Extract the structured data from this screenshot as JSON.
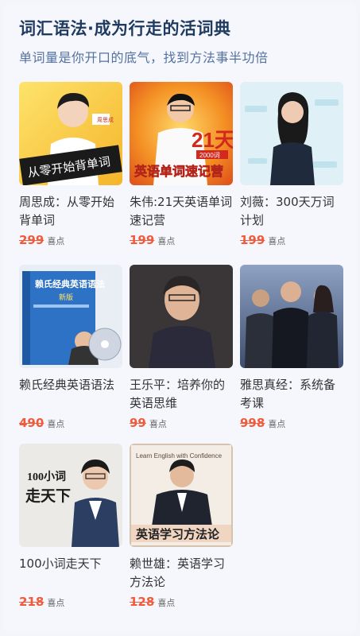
{
  "header": {
    "title": "词汇语法·成为行走的活词典",
    "subtitle": "单词量是你开口的底气，找到方法事半功倍"
  },
  "courses": [
    {
      "name": "周思成：从零开始背单词",
      "price": "299",
      "unit": "喜点",
      "cover_text": "从零开始背单词",
      "cover_badge": "周思成"
    },
    {
      "name": "朱伟:21天英语单词速记营",
      "price": "199",
      "unit": "喜点",
      "cover_text": "英语单词速记营",
      "cover_badge": "21天",
      "cover_sub": "2000词"
    },
    {
      "name": "刘薇：300天万词计划",
      "price": "199",
      "unit": "喜点"
    },
    {
      "name": "赖氏经典英语语法",
      "price": "490",
      "unit": "喜点",
      "cover_text": "赖氏经典英语语法",
      "cover_sub": "新版"
    },
    {
      "name": "王乐平：培养你的英语思维",
      "price": "99",
      "unit": "喜点"
    },
    {
      "name": "雅思真经：系统备考课",
      "price": "998",
      "unit": "喜点"
    },
    {
      "name": "100小词走天下",
      "price": "218",
      "unit": "喜点",
      "cover_text": "100小词",
      "cover_sub": "走天下"
    },
    {
      "name": "赖世雄：英语学习方法论",
      "price": "128",
      "unit": "喜点",
      "cover_text": "英语学习方法论",
      "cover_top": "Learn English with Confidence"
    }
  ]
}
